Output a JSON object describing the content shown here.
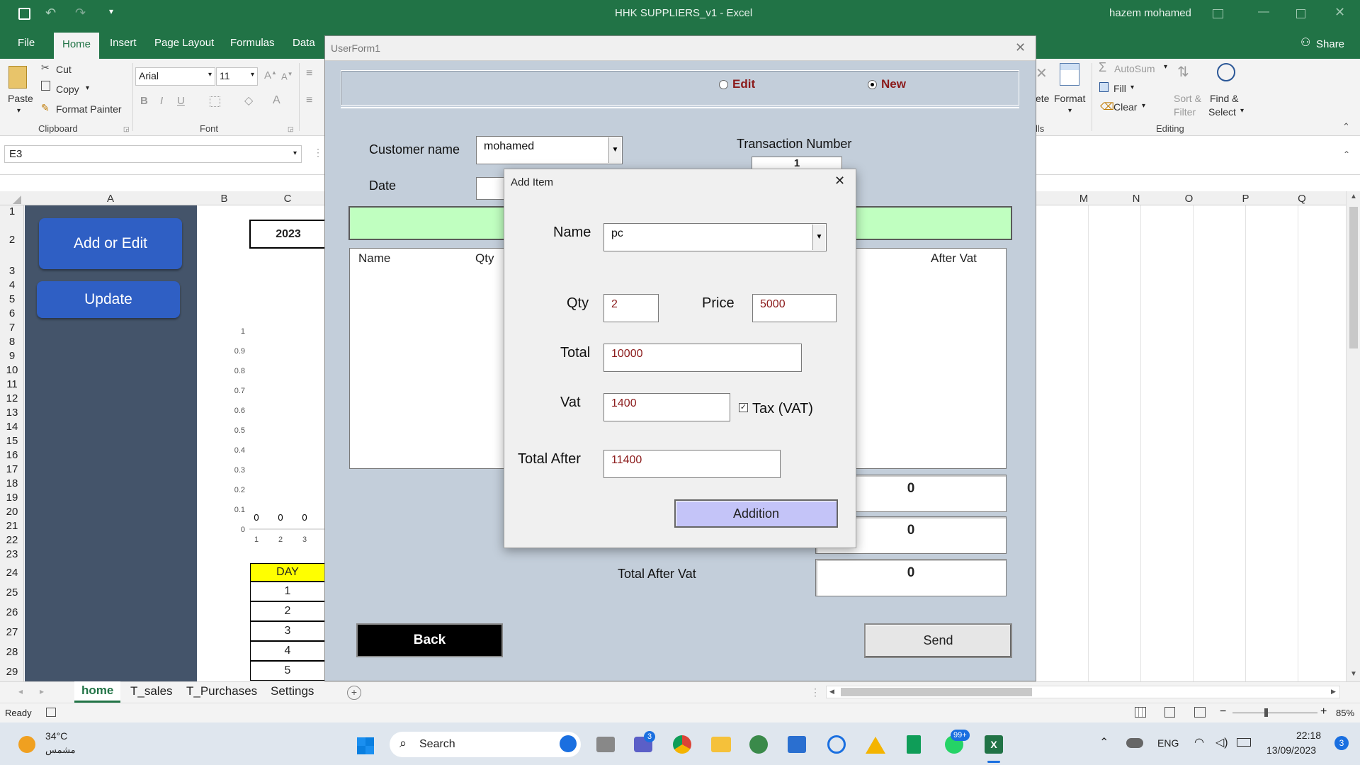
{
  "window": {
    "title": "HHK SUPPLIERS_v1  -  Excel",
    "user": "hazem mohamed",
    "share": "Share"
  },
  "ribbon": {
    "tabs": [
      "File",
      "Home",
      "Insert",
      "Page Layout",
      "Formulas",
      "Data"
    ],
    "clipboard": {
      "paste": "Paste",
      "cut": "Cut",
      "copy": "Copy",
      "format_painter": "Format Painter",
      "group": "Clipboard"
    },
    "font": {
      "family": "Arial",
      "size": "11",
      "group": "Font"
    },
    "cells": {
      "delete": "ete",
      "format": "Format",
      "group": "lls"
    },
    "editing": {
      "autosum": "AutoSum",
      "fill": "Fill",
      "clear": "Clear",
      "sort1": "Sort &",
      "sort2": "Filter",
      "find1": "Find &",
      "find2": "Select",
      "group": "Editing"
    }
  },
  "namebox": "E3",
  "columns": {
    "left": [
      "A",
      "B",
      "C"
    ],
    "right": [
      "M",
      "N",
      "O",
      "P",
      "Q"
    ]
  },
  "rows": [
    "1",
    "2",
    "3",
    "4",
    "5",
    "6",
    "7",
    "8",
    "9",
    "10",
    "11",
    "12",
    "13",
    "14",
    "15",
    "16",
    "17",
    "18",
    "19",
    "20",
    "21",
    "22",
    "23",
    "24",
    "25",
    "26",
    "27",
    "28",
    "29"
  ],
  "sheet": {
    "buttons": {
      "add_edit": "Add or Edit",
      "update": "Update"
    },
    "year": "2023",
    "day_header": "DAY",
    "days": [
      "1",
      "2",
      "3",
      "4",
      "5"
    ],
    "chart_data": {
      "type": "bar",
      "categories": [
        "1",
        "2",
        "3"
      ],
      "values": [
        0,
        0,
        0
      ],
      "data_labels": [
        "0",
        "0",
        "0"
      ],
      "ylim": [
        0,
        1
      ],
      "yticks": [
        "0",
        "0.1",
        "0.2",
        "0.3",
        "0.4",
        "0.5",
        "0.6",
        "0.7",
        "0.8",
        "0.9",
        "1"
      ]
    }
  },
  "sheet_tabs": [
    "home",
    "T_sales",
    "T_Purchases",
    "Settings"
  ],
  "status": {
    "ready": "Ready",
    "zoom": "85%"
  },
  "userform": {
    "title": "UserForm1",
    "edit": "Edit",
    "new": "New",
    "customer_label": "Customer name",
    "customer_value": "mohamed",
    "transaction_label": "Transaction Number",
    "transaction_value": "1",
    "date_label": "Date",
    "list_headers": {
      "name": "Name",
      "qty": "Qty",
      "after_vat": "After Vat"
    },
    "totals": [
      "0",
      "0",
      "0"
    ],
    "total_after_vat_label": "Total After Vat",
    "back": "Back",
    "send": "Send"
  },
  "add_item": {
    "title": "Add Item",
    "name_label": "Name",
    "name_value": "pc",
    "qty_label": "Qty",
    "qty_value": "2",
    "price_label": "Price",
    "price_value": "5000",
    "total_label": "Total",
    "total_value": "10000",
    "vat_label": "Vat",
    "vat_value": "1400",
    "tax_label": "Tax (VAT)",
    "total_after_label": "Total After",
    "total_after_value": "11400",
    "addition": "Addition"
  },
  "taskbar": {
    "temp": "34°C",
    "weather": "مشمس",
    "search": "Search",
    "lang": "ENG",
    "time": "22:18",
    "date": "13/09/2023",
    "badge1": "3",
    "badge2": "99+",
    "notif": "3"
  },
  "colors": {
    "excel_green": "#217346",
    "form_bg": "#c3ceda",
    "sheet_button": "#2f5fc4",
    "day_header": "#ffff00",
    "addition_btn": "#c4c4f8",
    "green_bar": "#c0ffc0"
  }
}
